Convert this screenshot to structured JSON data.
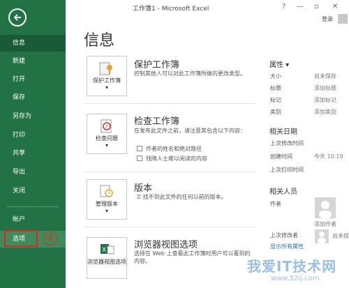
{
  "window": {
    "title": "工作簿1 - Microsoft Excel",
    "login": "登录"
  },
  "sidebar": {
    "items": [
      "信息",
      "新建",
      "打开",
      "保存",
      "另存为",
      "打印",
      "共享",
      "导出",
      "关闭",
      "帐户",
      "选项"
    ],
    "active": "信息",
    "selected": "选项"
  },
  "callout": {
    "number": "②"
  },
  "main": {
    "title": "信息",
    "sections": [
      {
        "button": "保护工作簿",
        "title": "保护工作簿",
        "desc": "控制其他人可以对此工作簿所做的更改类型。"
      },
      {
        "button": "检查问题",
        "title": "检查工作簿",
        "desc": "在发布此文件之前，请注意其包含以下内容：",
        "bullets": [
          "作者的姓名和绝对路径",
          "残障人士难以阅读的内容"
        ]
      },
      {
        "button": "管理版本",
        "title": "版本",
        "desc": "找不到此文件的任何以前的版本。"
      },
      {
        "button": "浏览器视图选项",
        "title": "浏览器视图选项",
        "desc": "选择在 Web 上查看此工作簿时用户可以看到的内容。"
      }
    ]
  },
  "properties": {
    "head": "属性 ▾",
    "rows": [
      {
        "label": "大小",
        "value": "尚未保存"
      },
      {
        "label": "标题",
        "value": "添加标题"
      },
      {
        "label": "标记",
        "value": "添加标记"
      },
      {
        "label": "类别",
        "value": "添加类别"
      }
    ],
    "dates_head": "相关日期",
    "dates": [
      {
        "label": "上次修改时间",
        "value": ""
      },
      {
        "label": "创建时间",
        "value": "今天 10:19"
      },
      {
        "label": "上次打印时间",
        "value": ""
      }
    ],
    "people_head": "相关人员",
    "author_label": "作者",
    "add_author": "添加作者",
    "last_modified_by": "上次修改者",
    "not_saved": "尚未保存",
    "show_all": "显示所有属性"
  },
  "watermark": {
    "text": "我爱IT技术网",
    "url": "www.52ij.com"
  },
  "colors": {
    "sidebar": "#217346",
    "callout": "#e2261d",
    "link": "#2f6fb2"
  }
}
